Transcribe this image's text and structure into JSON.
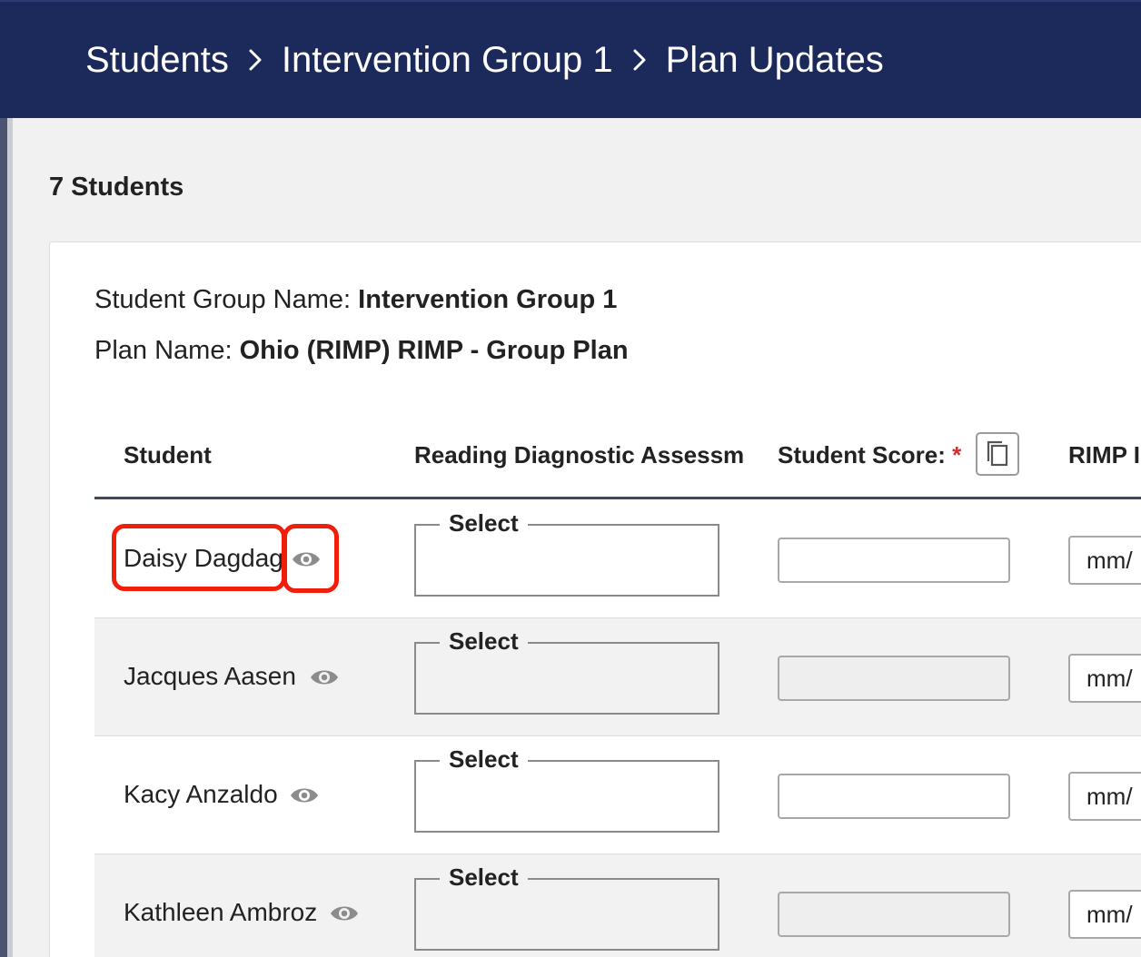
{
  "breadcrumb": {
    "items": [
      "Students",
      "Intervention Group 1",
      "Plan Updates"
    ]
  },
  "summary": {
    "count_label": "7 Students"
  },
  "group_info": {
    "group_name_label": "Student Group Name:",
    "group_name_value": "Intervention Group 1",
    "plan_name_label": "Plan Name:",
    "plan_name_value": "Ohio (RIMP) RIMP - Group Plan"
  },
  "table": {
    "columns": {
      "student": "Student",
      "assessment": "Reading Diagnostic Assessm",
      "score": "Student Score:",
      "score_required": "*",
      "rimp": "RIMP I"
    },
    "rows": [
      {
        "student": "Daisy Dagdag",
        "select_label": "Select",
        "date_placeholder": "mm/"
      },
      {
        "student": "Jacques Aasen",
        "select_label": "Select",
        "date_placeholder": "mm/"
      },
      {
        "student": "Kacy Anzaldo",
        "select_label": "Select",
        "date_placeholder": "mm/"
      },
      {
        "student": "Kathleen Ambroz",
        "select_label": "Select",
        "date_placeholder": "mm/"
      }
    ]
  },
  "icons": {
    "breadcrumb_separator": "chevron-right-icon",
    "view_student": "eye-icon",
    "copy_down": "copy-icon"
  },
  "colors": {
    "header_bg": "#1b2a5a",
    "highlight": "#f01e0a",
    "required": "#d32f2f"
  }
}
